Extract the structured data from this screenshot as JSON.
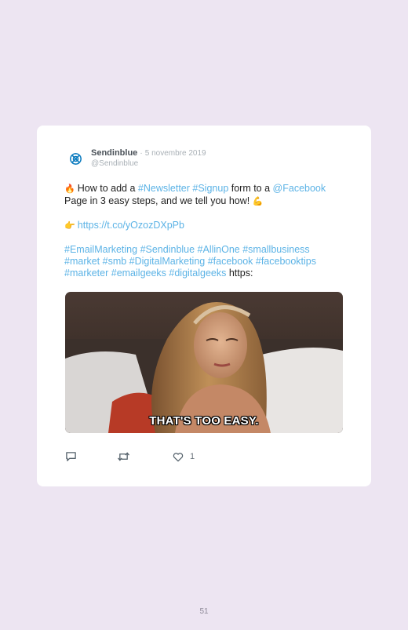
{
  "tweet": {
    "author_name": "Sendinblue",
    "separator": "·",
    "date": "5 novembre 2019",
    "handle": "@Sendinblue",
    "lines": [
      [
        {
          "t": "🔥 ",
          "k": "emoji"
        },
        {
          "t": "How to add a ",
          "k": "text"
        },
        {
          "t": "#Newsletter",
          "k": "tag"
        },
        {
          "t": " ",
          "k": "text"
        },
        {
          "t": "#Signup",
          "k": "tag"
        },
        {
          "t": " form to a ",
          "k": "text"
        },
        {
          "t": "@Facebook",
          "k": "tag"
        }
      ],
      [
        {
          "t": "Page in 3 easy steps, and we tell you how! ",
          "k": "text"
        },
        {
          "t": "💪",
          "k": "emoji"
        }
      ],
      [],
      [
        {
          "t": "👉 ",
          "k": "emoji"
        },
        {
          "t": "https://t.co/yOzozDXpPb",
          "k": "tag"
        }
      ],
      [],
      [
        {
          "t": "#EmailMarketing #Sendinblue #AllinOne #smallbusiness",
          "k": "tag"
        }
      ],
      [
        {
          "t": "#market #smb #DigitalMarketing #facebook #facebooktips",
          "k": "tag"
        }
      ],
      [
        {
          "t": "#marketer #emailgeeks #digitalgeeks",
          "k": "tag"
        },
        {
          "t": " https:",
          "k": "text"
        }
      ]
    ],
    "media": {
      "caption": "THAT'S TOO EASY."
    },
    "actions": {
      "reply_icon": "reply-icon",
      "retweet_icon": "retweet-icon",
      "like_icon": "heart-icon",
      "like_count": "1"
    }
  },
  "page": {
    "number": "51"
  },
  "colors": {
    "background": "#ede5f2",
    "link": "#5cb3e6",
    "brand": "#0b7bbf"
  }
}
